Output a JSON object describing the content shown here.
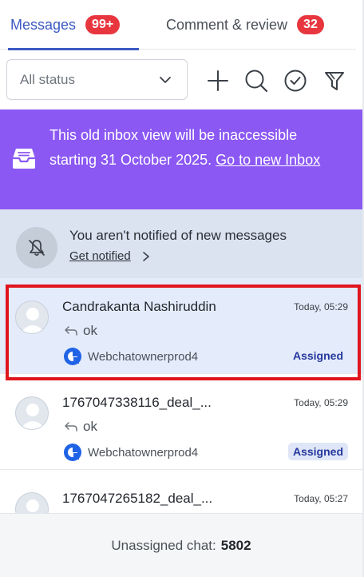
{
  "tabs": [
    {
      "label": "Messages",
      "badge": "99+"
    },
    {
      "label": "Comment & review",
      "badge": "32"
    }
  ],
  "filter": {
    "status_value": "All status"
  },
  "icons": {
    "add": "plus-icon",
    "search": "search-icon",
    "resolve": "check-circle-icon",
    "filter": "funnel-icon"
  },
  "banner": {
    "text": "This old inbox view will be inaccessible starting 31 October 2025. ",
    "link": "Go to new Inbox"
  },
  "notify": {
    "title": "You aren't notified of new messages",
    "link": "Get notified"
  },
  "conversations": [
    {
      "name": "Candrakanta Nashiruddin",
      "time": "Today, 05:29",
      "reply": "ok",
      "channel": "Webchatownerprod4",
      "status": "Assigned"
    },
    {
      "name": "1767047338116_deal_...",
      "time": "Today, 05:29",
      "reply": "ok",
      "channel": "Webchatownerprod4",
      "status": "Assigned"
    },
    {
      "name": "1767047265182_deal_...",
      "time": "Today, 05:27",
      "reply": "",
      "channel": "",
      "status": ""
    }
  ],
  "footer": {
    "label": "Unassigned chat:",
    "count": "5802"
  },
  "colors": {
    "accent": "#3c5ac3",
    "badge": "#e8363f",
    "banner": "#8b58f4",
    "highlight": "#e0161e"
  }
}
